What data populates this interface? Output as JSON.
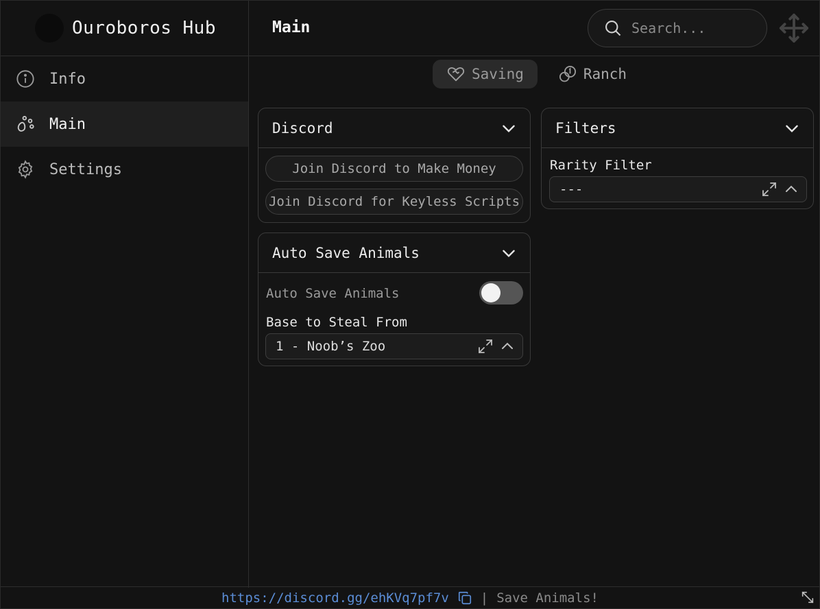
{
  "app": {
    "title": "Ouroboros Hub"
  },
  "sidebar": {
    "items": [
      {
        "label": "Info",
        "icon": "info-icon"
      },
      {
        "label": "Main",
        "icon": "paw-icon",
        "active": true
      },
      {
        "label": "Settings",
        "icon": "gear-icon"
      }
    ]
  },
  "header": {
    "title": "Main",
    "search_placeholder": "Search..."
  },
  "tabs": [
    {
      "label": "Saving",
      "icon": "heart-handshake-icon",
      "active": true
    },
    {
      "label": "Ranch",
      "icon": "coins-icon"
    }
  ],
  "panels": {
    "discord": {
      "title": "Discord",
      "buttons": [
        "Join Discord to Make Money",
        "Join Discord for Keyless Scripts"
      ]
    },
    "auto_save": {
      "title": "Auto Save Animals",
      "toggle_label": "Auto Save Animals",
      "toggle_on": false,
      "base_label": "Base to Steal From",
      "base_value": "1 - Noob’s Zoo"
    },
    "filters": {
      "title": "Filters",
      "rarity_label": "Rarity Filter",
      "rarity_value": "---"
    }
  },
  "footer": {
    "link": "https://discord.gg/ehKVq7pf7v",
    "separator": "|",
    "status": "Save Animals!"
  },
  "colors": {
    "accent_link": "#5b8dd6",
    "background": "#131313",
    "border": "#3a3a3a"
  }
}
